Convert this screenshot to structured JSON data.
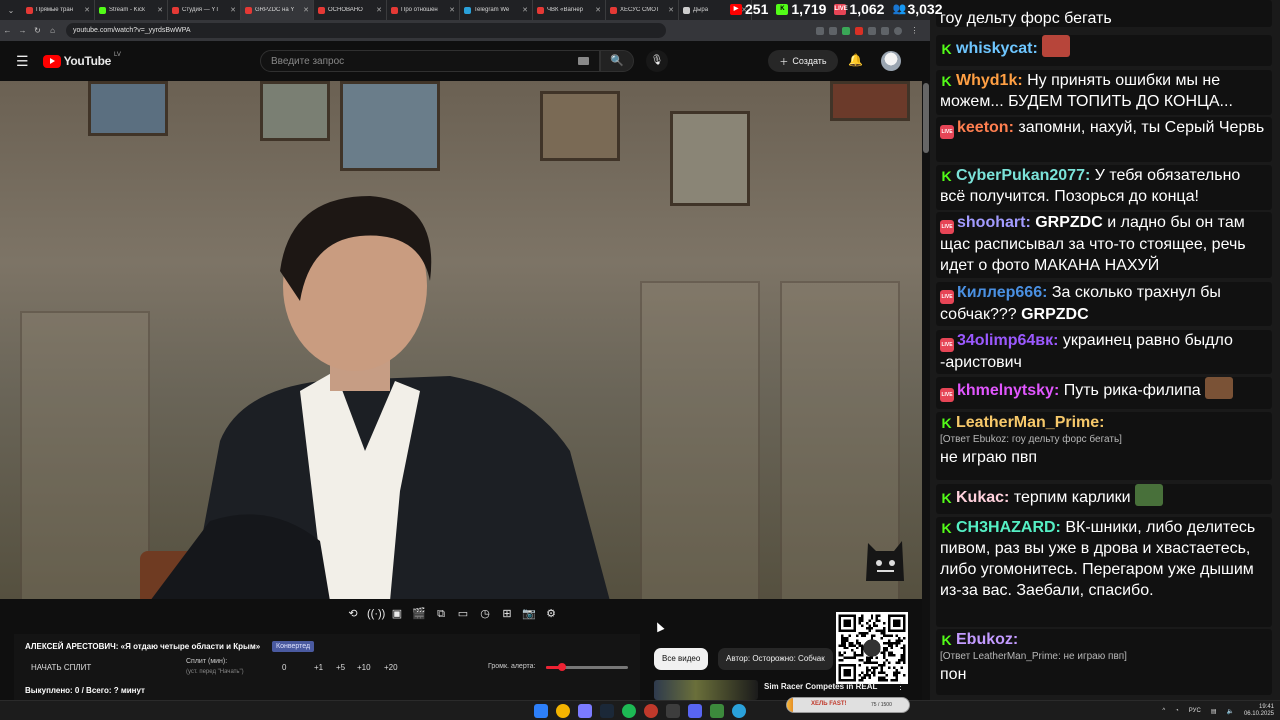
{
  "browser": {
    "tabs": [
      {
        "title": "Прямые тран",
        "color": "#e53935"
      },
      {
        "title": "Stream - Kick",
        "color": "#53fc18"
      },
      {
        "title": "Студия — YT",
        "color": "#e53935"
      },
      {
        "title": "GRPZDC на Y",
        "color": "#e53935"
      },
      {
        "title": "ОСНОВАНО",
        "color": "#e53935"
      },
      {
        "title": "Про отношен",
        "color": "#e53935"
      },
      {
        "title": "Telegram We",
        "color": "#2aa1da"
      },
      {
        "title": "ЧВК «Вагнер",
        "color": "#e53935"
      },
      {
        "title": "ХЕСУС СМОТ",
        "color": "#e53935"
      },
      {
        "title": "Дыра",
        "color": "#cccccc"
      }
    ],
    "url": "youtube.com/watch?v=_yyrdsBwWPA"
  },
  "stats": {
    "viewers_1": "251",
    "viewers_2": "1,719",
    "viewers_3": "1,062",
    "viewers_4": "3,032"
  },
  "youtube": {
    "logo_text": "YouTube",
    "country": "LV",
    "search_placeholder": "Введите запрос",
    "create_label": "Создать"
  },
  "split_panel": {
    "title": "АЛЕКСЕЙ АРЕСТОВИЧ: «Я отдаю четыре области и Крым»",
    "tag": "Конвертед",
    "start_label": "НАЧАТЬ СПЛИТ",
    "split_label": "Сплит (мин):",
    "split_hint": "(уст. перед \"Начать\")",
    "split_value": "0",
    "steps": [
      "+1",
      "+5",
      "+10",
      "+20"
    ],
    "alert_label": "Громк. алерта:",
    "alert_level": 0.2,
    "summary": "Выкуплено: 0 / Всего: ? минут"
  },
  "recommendations": {
    "chip_all": "Все видео",
    "chip_author": "Автор: Осторожно: Собчак",
    "video_title": "Sim Racer Competes in REAL"
  },
  "chat": {
    "messages": [
      {
        "platform": "none",
        "user": "",
        "color": "#ffffff",
        "text": "гоу дельту форс бегать"
      },
      {
        "platform": "kick",
        "user": "whiskycat:",
        "color": "#6ec6ff",
        "text": ""
      },
      {
        "platform": "kick",
        "user": "Whyd1k:",
        "color": "#ff9f43",
        "text": "Ну принять ошибки мы не можем... БУДЕМ ТОПИТЬ ДО КОНЦА..."
      },
      {
        "platform": "live",
        "user": "keeton:",
        "color": "#ff7f50",
        "text": "запомни, нахуй, ты Серый Червь"
      },
      {
        "platform": "kick",
        "user": "CyberPukan2077:",
        "color": "#7be3d9",
        "text": "У тебя обязательно всё получится. Позорься до конца!"
      },
      {
        "platform": "live",
        "user": "shoohart:",
        "color": "#a29bfe",
        "text_bold": "GRPZDC",
        "text": "и ладно бы он там щас расписывал за что-то стоящее, речь идет о фото МАКАНА НАХУЙ"
      },
      {
        "platform": "live",
        "user": "Киллер666:",
        "color": "#4a90e2",
        "text": "За сколько трахнул бы собчак???",
        "text_bold_after": "GRPZDC"
      },
      {
        "platform": "live",
        "user": "34olimp64вк:",
        "color": "#9b59ff",
        "text": "украинец равно быдло -аристович"
      },
      {
        "platform": "live",
        "user": "khmelnytsky:",
        "color": "#e056fd",
        "text": "Путь рика-филипа"
      },
      {
        "platform": "kick",
        "user": "LeatherMan_Prime:",
        "color": "#f6c86a",
        "reply": "[Ответ Ebukoz: гоу дельту форс бегать]",
        "text": "не играю пвп"
      },
      {
        "platform": "kick",
        "user": "Kukac:",
        "color": "#ffd1dc",
        "text": "терпим карлики"
      },
      {
        "platform": "kick",
        "user": "CH3HAZARD:",
        "color": "#55efc4",
        "text": "ВК-шники, либо делитесь пивом, раз вы уже в дрова и хвастаетесь, либо угомонитесь. Перегаром уже дышим из-за вас. Заебали, спасибо."
      },
      {
        "platform": "kick",
        "user": "Ebukoz:",
        "color": "#c39bff",
        "reply": "[Ответ LeatherMan_Prime: не играю пвп]",
        "text": "пон"
      }
    ]
  },
  "taskbar": {
    "goal_label": "ХЕЛЬ FAST!",
    "goal_count": "75 / 1500",
    "goal_progress": 0.05,
    "lang": "РУС",
    "time": "19:41",
    "date": "06.10.2025"
  }
}
